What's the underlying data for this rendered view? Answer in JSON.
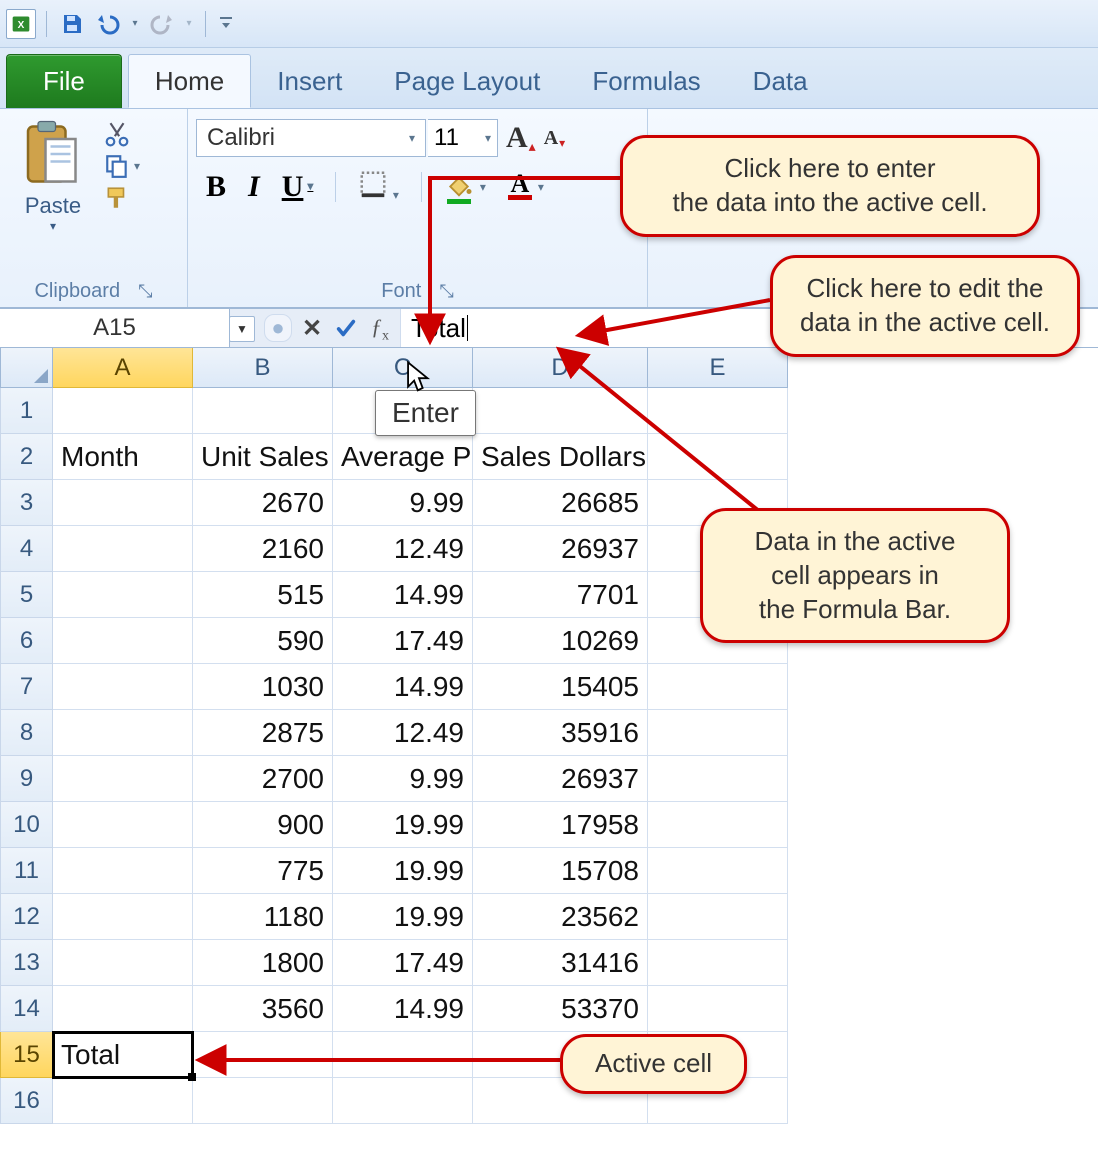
{
  "qat": {
    "appTitle": "Excel"
  },
  "tabs": {
    "file": "File",
    "items": [
      "Home",
      "Insert",
      "Page Layout",
      "Formulas",
      "Data"
    ],
    "activeIndex": 0
  },
  "ribbon": {
    "clipboard": {
      "paste": "Paste",
      "title": "Clipboard"
    },
    "font": {
      "name": "Calibri",
      "size": "11",
      "title": "Font"
    }
  },
  "formulaBar": {
    "nameBox": "A15",
    "value": "Total",
    "enterTooltip": "Enter"
  },
  "sheet": {
    "columns": [
      "A",
      "B",
      "C",
      "D",
      "E"
    ],
    "headerRow": 2,
    "headers": {
      "A": "Month",
      "B": "Unit Sales",
      "C": "Average P",
      "D": "Sales Dollars"
    },
    "rowNumbers": [
      1,
      2,
      3,
      4,
      5,
      6,
      7,
      8,
      9,
      10,
      11,
      12,
      13,
      14,
      15,
      16
    ],
    "data": [
      {
        "B": "2670",
        "C": "9.99",
        "D": "26685"
      },
      {
        "B": "2160",
        "C": "12.49",
        "D": "26937"
      },
      {
        "B": "515",
        "C": "14.99",
        "D": "7701"
      },
      {
        "B": "590",
        "C": "17.49",
        "D": "10269"
      },
      {
        "B": "1030",
        "C": "14.99",
        "D": "15405"
      },
      {
        "B": "2875",
        "C": "12.49",
        "D": "35916"
      },
      {
        "B": "2700",
        "C": "9.99",
        "D": "26937"
      },
      {
        "B": "900",
        "C": "19.99",
        "D": "17958"
      },
      {
        "B": "775",
        "C": "19.99",
        "D": "15708"
      },
      {
        "B": "1180",
        "C": "19.99",
        "D": "23562"
      },
      {
        "B": "1800",
        "C": "17.49",
        "D": "31416"
      },
      {
        "B": "3560",
        "C": "14.99",
        "D": "53370"
      }
    ],
    "activeCell": {
      "row": 15,
      "col": "A",
      "value": "Total"
    }
  },
  "callouts": {
    "enterData": "Click here to enter\nthe data into the active cell.",
    "editData": "Click here to edit the\ndata in the active cell.",
    "formulaBar": "Data in the active\ncell appears in\nthe Formula Bar.",
    "activeCell": "Active cell"
  }
}
